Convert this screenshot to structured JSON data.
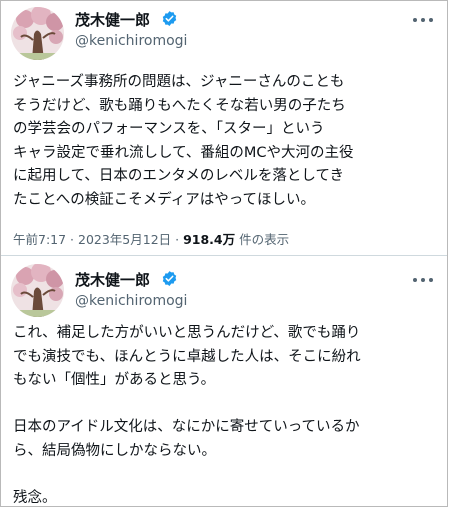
{
  "tweets": [
    {
      "author_name": "茂木健一郎",
      "author_handle": "@kenichiromogi",
      "text": "ジャニーズ事務所の問題は、ジャニーさんのことも\nそうだけど、歌も踊りもへたくそな若い男の子たち\nの学芸会のパフォーマンスを、「スター」という\nキャラ設定で垂れ流しして、番組のMCや大河の主役\nに起用して、日本のエンタメのレベルを落としてき\nたことへの検証こそメディアはやってほしい。",
      "time": "午前7:17",
      "dot1": " · ",
      "date": "2023年5月12日",
      "dot2": " · ",
      "views_count": "918.4万",
      "views_label": " 件の表示"
    },
    {
      "author_name": "茂木健一郎",
      "author_handle": "@kenichiromogi",
      "text": "これ、補足した方がいいと思うんだけど、歌でも踊り\nでも演技でも、ほんとうに卓越した人は、そこに紛れ\nもない「個性」があると思う。\n\n日本のアイドル文化は、なにかに寄せていっているか\nら、結局偽物にしかならない。\n\n残念。"
    }
  ],
  "icons": {
    "verified": "verified-badge-icon",
    "more": "more-options-icon"
  },
  "colors": {
    "verified_blue": "#1d9bf0",
    "secondary_text": "#536471",
    "primary_text": "#0f1419"
  }
}
